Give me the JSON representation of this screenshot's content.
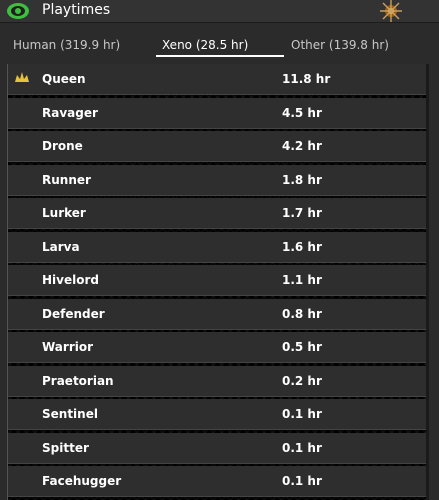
{
  "window": {
    "title": "Playtimes",
    "icons": {
      "app": "eye-icon",
      "faction": "faction-emblem-icon"
    }
  },
  "tabs": [
    {
      "label": "Human (319.9 hr)",
      "active": false
    },
    {
      "label": "Xeno (28.5 hr)",
      "active": true
    },
    {
      "label": "Other (139.8 hr)",
      "active": false
    }
  ],
  "rows": [
    {
      "name": "Queen",
      "time": "11.8 hr",
      "icon": "crown-icon"
    },
    {
      "name": "Ravager",
      "time": "4.5 hr"
    },
    {
      "name": "Drone",
      "time": "4.2 hr"
    },
    {
      "name": "Runner",
      "time": "1.8 hr"
    },
    {
      "name": "Lurker",
      "time": "1.7 hr"
    },
    {
      "name": "Larva",
      "time": "1.6 hr"
    },
    {
      "name": "Hivelord",
      "time": "1.1 hr"
    },
    {
      "name": "Defender",
      "time": "0.8 hr"
    },
    {
      "name": "Warrior",
      "time": "0.5 hr"
    },
    {
      "name": "Praetorian",
      "time": "0.2 hr"
    },
    {
      "name": "Sentinel",
      "time": "0.1 hr"
    },
    {
      "name": "Spitter",
      "time": "0.1 hr"
    },
    {
      "name": "Facehugger",
      "time": "0.1 hr"
    }
  ],
  "colors": {
    "accent": "#3fbf3f",
    "crown": "#e8c23a",
    "background": "#2b2b2b",
    "row": "#2e2e2e"
  }
}
